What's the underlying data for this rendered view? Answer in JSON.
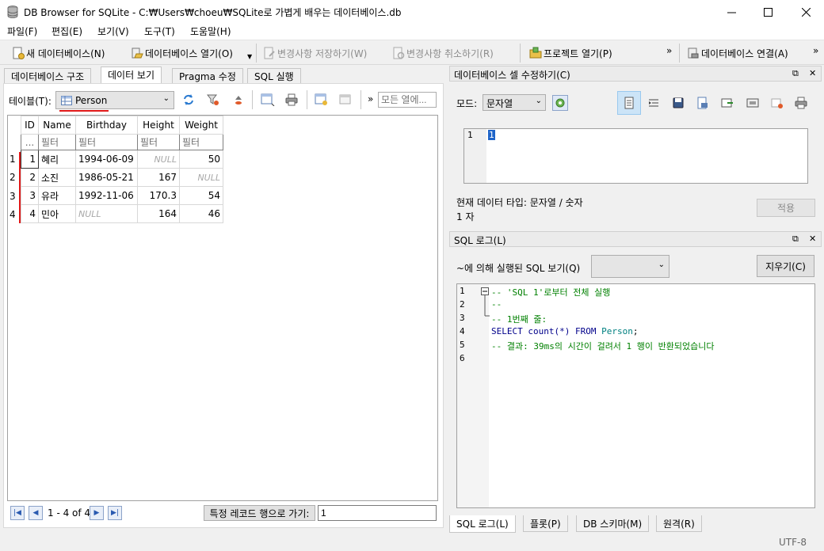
{
  "window": {
    "title": "DB Browser for SQLite - C:₩Users₩choeu₩SQLite로 가볍게 배우는 데이터베이스.db"
  },
  "menu": [
    "파일(F)",
    "편집(E)",
    "보기(V)",
    "도구(T)",
    "도움말(H)"
  ],
  "toolbar": {
    "new_db": "새 데이터베이스(N)",
    "open_db": "데이터베이스 열기(O)",
    "write_changes": "변경사항 저장하기(W)",
    "revert_changes": "변경사항 취소하기(R)",
    "open_project": "프로젝트 열기(P)",
    "attach_db": "데이터베이스 연결(A)",
    "overflow": "»"
  },
  "tabs": [
    "데이터베이스 구조",
    "데이터 보기",
    "Pragma 수정",
    "SQL 실행"
  ],
  "browse": {
    "table_label": "테이블(T):",
    "table_value": "Person",
    "filter_all_placeholder": "모든 열에...",
    "overflow": "»",
    "columns": [
      "ID",
      "Name",
      "Birthday",
      "Height",
      "Weight"
    ],
    "filter_corner": "...",
    "filter_placeholder": "필터",
    "rows": [
      {
        "n": "1",
        "id": "1",
        "name": "혜리",
        "birthday": "1994-06-09",
        "height": "NULL",
        "weight": "50"
      },
      {
        "n": "2",
        "id": "2",
        "name": "소진",
        "birthday": "1986-05-21",
        "height": "167",
        "weight": "NULL"
      },
      {
        "n": "3",
        "id": "3",
        "name": "유라",
        "birthday": "1992-11-06",
        "height": "170.3",
        "weight": "54"
      },
      {
        "n": "4",
        "id": "4",
        "name": "민아",
        "birthday": "NULL",
        "height": "164",
        "weight": "46"
      }
    ],
    "record_count": "1 - 4 of 4",
    "goto_label": "특정 레코드 행으로 가기:",
    "goto_value": "1"
  },
  "edit_cell": {
    "header": "데이터베이스 셀 수정하기(C)",
    "mode_label": "모드:",
    "mode_value": "문자열",
    "line_number": "1",
    "cell_value": "1",
    "type_text": "현재 데이터 타입: 문자열 / 숫자",
    "size_text": "1 자",
    "apply_label": "적용"
  },
  "sql_log": {
    "header": "SQL 로그(L)",
    "show_label": "~에 의해 실행된 SQL 보기(Q)",
    "clear_label": "지우기(C)",
    "lines": [
      "1",
      "2",
      "3",
      "4",
      "5",
      "6"
    ],
    "code": {
      "l1": "-- 'SQL 1'로부터 전체 실행",
      "l2": "--",
      "l3": "-- 1번째 줄:",
      "l4_kw1": "SELECT",
      "l4_fn": " count(*) ",
      "l4_kw2": "FROM",
      "l4_tbl": " Person",
      "l4_end": ";",
      "l5": "-- 결과: 39ms의 시간이 걸려서 1 행이 반환되었습니다"
    }
  },
  "dock_buttons": {
    "float": "⧉",
    "close": "✕"
  },
  "bottom_tabs": [
    "SQL 로그(L)",
    "플롯(P)",
    "DB 스키마(M)",
    "원격(R)"
  ],
  "status": {
    "encoding": "UTF-8"
  }
}
